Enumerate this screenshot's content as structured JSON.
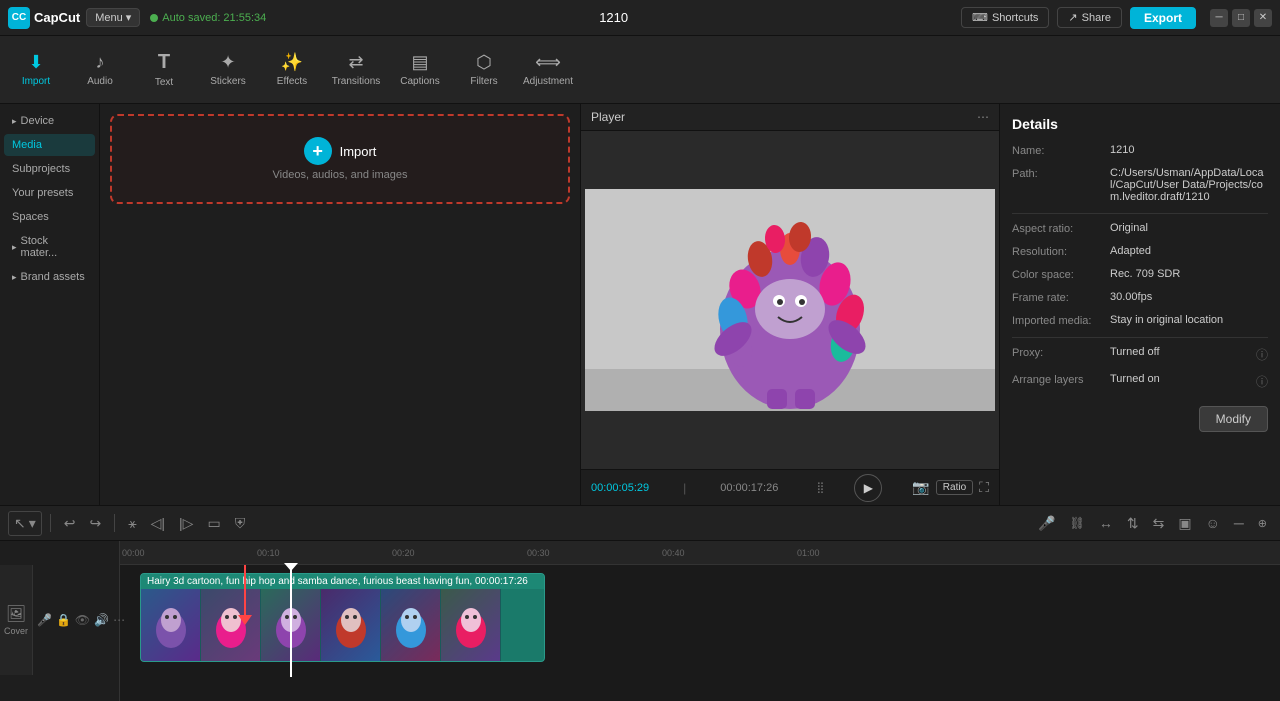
{
  "app": {
    "name": "CapCut",
    "title": "1210",
    "autosave": "Auto saved: 21:55:34"
  },
  "topbar": {
    "menu_label": "Menu",
    "shortcuts_label": "Shortcuts",
    "share_label": "Share",
    "export_label": "Export"
  },
  "toolbar": {
    "items": [
      {
        "id": "import",
        "label": "Import",
        "icon": "⬇",
        "active": true
      },
      {
        "id": "audio",
        "label": "Audio",
        "icon": "♪"
      },
      {
        "id": "text",
        "label": "Text",
        "icon": "T"
      },
      {
        "id": "stickers",
        "label": "Stickers",
        "icon": "✦"
      },
      {
        "id": "effects",
        "label": "Effects",
        "icon": "✨"
      },
      {
        "id": "transitions",
        "label": "Transitions",
        "icon": "⇄"
      },
      {
        "id": "captions",
        "label": "Captions",
        "icon": "▤"
      },
      {
        "id": "filters",
        "label": "Filters",
        "icon": "⬡"
      },
      {
        "id": "adjustment",
        "label": "Adjustment",
        "icon": "⟺"
      }
    ]
  },
  "sidebar": {
    "items": [
      {
        "id": "device",
        "label": "Device",
        "arrow": true,
        "active": false
      },
      {
        "id": "media",
        "label": "Media",
        "active": true
      },
      {
        "id": "subprojects",
        "label": "Subprojects",
        "active": false
      },
      {
        "id": "your-presets",
        "label": "Your presets",
        "active": false
      },
      {
        "id": "spaces",
        "label": "Spaces",
        "active": false
      },
      {
        "id": "stock-mater",
        "label": "Stock mater...",
        "arrow": true,
        "active": false
      },
      {
        "id": "brand-assets",
        "label": "Brand assets",
        "arrow": true,
        "active": false
      }
    ]
  },
  "media": {
    "import_label": "Import",
    "import_sub": "Videos, audios, and images"
  },
  "player": {
    "title": "Player",
    "current_time": "00:00:05:29",
    "total_time": "00:00:17:26",
    "ratio_label": "Ratio"
  },
  "details": {
    "title": "Details",
    "fields": [
      {
        "label": "Name:",
        "value": "1210"
      },
      {
        "label": "Path:",
        "value": "C:/Users/Usman/AppData/Local/CapCut/User Data/Projects/com.lveditor.draft/1210"
      },
      {
        "label": "Aspect ratio:",
        "value": "Original"
      },
      {
        "label": "Resolution:",
        "value": "Adapted"
      },
      {
        "label": "Color space:",
        "value": "Rec. 709 SDR"
      },
      {
        "label": "Frame rate:",
        "value": "30.00fps"
      },
      {
        "label": "Imported media:",
        "value": "Stay in original location"
      },
      {
        "label": "Proxy:",
        "value": "Turned off"
      },
      {
        "label": "Arrange layers",
        "value": "Turned on"
      }
    ],
    "modify_label": "Modify"
  },
  "timeline": {
    "track_text": "Hairy 3d cartoon, fun hip hop and samba dance, furious beast having fun,  00:00:17:26",
    "cover_label": "Cover",
    "timestamps": [
      "00:00",
      "00:10",
      "00:20",
      "00:30",
      "00:40"
    ]
  }
}
